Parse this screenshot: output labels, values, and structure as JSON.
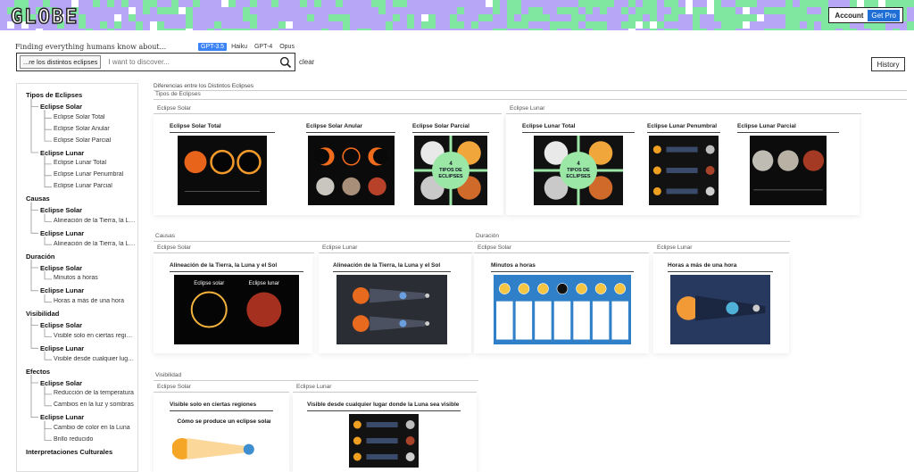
{
  "header": {
    "logo": "GLOBE",
    "account_label": "Account",
    "pro_label": "Get Pro"
  },
  "search": {
    "tagline": "Finding everything humans know about...",
    "models": [
      {
        "label": "GPT-3.5",
        "active": true
      },
      {
        "label": "Haiku",
        "active": false
      },
      {
        "label": "GPT-4",
        "active": false
      },
      {
        "label": "Opus",
        "active": false
      }
    ],
    "chip": "...re los distintos eclipses",
    "placeholder": "I want to discover...",
    "clear_label": "clear",
    "history_label": "History"
  },
  "sidebar": {
    "items": [
      {
        "level": 1,
        "label": "Tipos de Eclipses"
      },
      {
        "level": 2,
        "label": "Eclipse Solar"
      },
      {
        "level": 3,
        "label": "Eclipse Solar Total"
      },
      {
        "level": 3,
        "label": "Eclipse Solar Anular"
      },
      {
        "level": 3,
        "label": "Eclipse Solar Parcial"
      },
      {
        "level": 2,
        "label": "Eclipse Lunar"
      },
      {
        "level": 3,
        "label": "Eclipse Lunar Total"
      },
      {
        "level": 3,
        "label": "Eclipse Lunar Penumbral"
      },
      {
        "level": 3,
        "label": "Eclipse Lunar Parcial"
      },
      {
        "level": 1,
        "label": "Causas"
      },
      {
        "level": 2,
        "label": "Eclipse Solar"
      },
      {
        "level": 3,
        "label": "Alineación de la Tierra, la Luna y el Sol"
      },
      {
        "level": 2,
        "label": "Eclipse Lunar"
      },
      {
        "level": 3,
        "label": "Alineación de la Tierra, la Luna y el Sol"
      },
      {
        "level": 1,
        "label": "Duración"
      },
      {
        "level": 2,
        "label": "Eclipse Solar"
      },
      {
        "level": 3,
        "label": "Minutos a horas"
      },
      {
        "level": 2,
        "label": "Eclipse Lunar"
      },
      {
        "level": 3,
        "label": "Horas a más de una hora"
      },
      {
        "level": 1,
        "label": "Visibilidad"
      },
      {
        "level": 2,
        "label": "Eclipse Solar"
      },
      {
        "level": 3,
        "label": "Visible solo en ciertas regiones"
      },
      {
        "level": 2,
        "label": "Eclipse Lunar"
      },
      {
        "level": 3,
        "label": "Visible desde cualquier lugar donde la Luna sea visible"
      },
      {
        "level": 1,
        "label": "Efectos"
      },
      {
        "level": 2,
        "label": "Eclipse Solar"
      },
      {
        "level": 3,
        "label": "Reducción de la temperatura"
      },
      {
        "level": 3,
        "label": "Cambios en la luz y sombras"
      },
      {
        "level": 2,
        "label": "Eclipse Lunar"
      },
      {
        "level": 3,
        "label": "Cambio de color en la Luna"
      },
      {
        "level": 3,
        "label": "Brillo reducido"
      },
      {
        "level": 1,
        "label": "Interpretaciones Culturales"
      }
    ]
  },
  "main": {
    "breadcrumb": "Diferencias entre los Distintos Eclipses",
    "sections": [
      {
        "title": "Tipos de Eclipses",
        "groups": [
          {
            "title": "Eclipse Solar",
            "cards": [
              {
                "title": "Eclipse Solar Total",
                "thumb": "solar-total"
              },
              {
                "title": "Eclipse Solar Anular",
                "thumb": "solar-anular"
              },
              {
                "title": "Eclipse Solar Parcial",
                "thumb": "tipos-green",
                "caption": "4 TIPOS DE ECLIPSES"
              }
            ]
          },
          {
            "title": "Eclipse Lunar",
            "cards": [
              {
                "title": "Eclipse Lunar Total",
                "thumb": "tipos-green",
                "caption": "4 TIPOS DE ECLIPSES"
              },
              {
                "title": "Eclipse Lunar Penumbral",
                "thumb": "penumbral"
              },
              {
                "title": "Eclipse Lunar Parcial",
                "thumb": "moons"
              }
            ]
          }
        ]
      },
      {
        "title": "Causas",
        "groups": [
          {
            "title": "Eclipse Solar",
            "cards": [
              {
                "title": "Alineación de la Tierra, la Luna y el Sol",
                "thumb": "solar-lunar",
                "labels": [
                  "Eclipse solar",
                  "Eclipse lunar"
                ]
              }
            ]
          },
          {
            "title": "Eclipse Lunar",
            "cards": [
              {
                "title": "Alineación de la Tierra, la Luna y el Sol",
                "thumb": "alignment"
              }
            ]
          }
        ]
      },
      {
        "title": "Duración",
        "groups": [
          {
            "title": "Eclipse Solar",
            "cards": [
              {
                "title": "Minutos a horas",
                "thumb": "phases-blue"
              }
            ]
          },
          {
            "title": "Eclipse Lunar",
            "cards": [
              {
                "title": "Horas a más de una hora",
                "thumb": "diagram-dark"
              }
            ]
          }
        ]
      },
      {
        "title": "Visibilidad",
        "groups": [
          {
            "title": "Eclipse Solar",
            "cards": [
              {
                "title": "Visible solo en ciertas regiones",
                "thumb": "como-se-produce",
                "caption": "Cómo se produce un eclipse solar"
              }
            ]
          },
          {
            "title": "Eclipse Lunar",
            "cards": [
              {
                "title": "Visible desde cualquier lugar donde la Luna sea visible",
                "thumb": "penumbral"
              }
            ]
          }
        ]
      }
    ]
  },
  "colors": {
    "banner_bg": "#b7a6f5",
    "banner_green": "#7fe7a0",
    "accent_blue": "#3b82f6",
    "panel_green": "#9be7a6"
  }
}
